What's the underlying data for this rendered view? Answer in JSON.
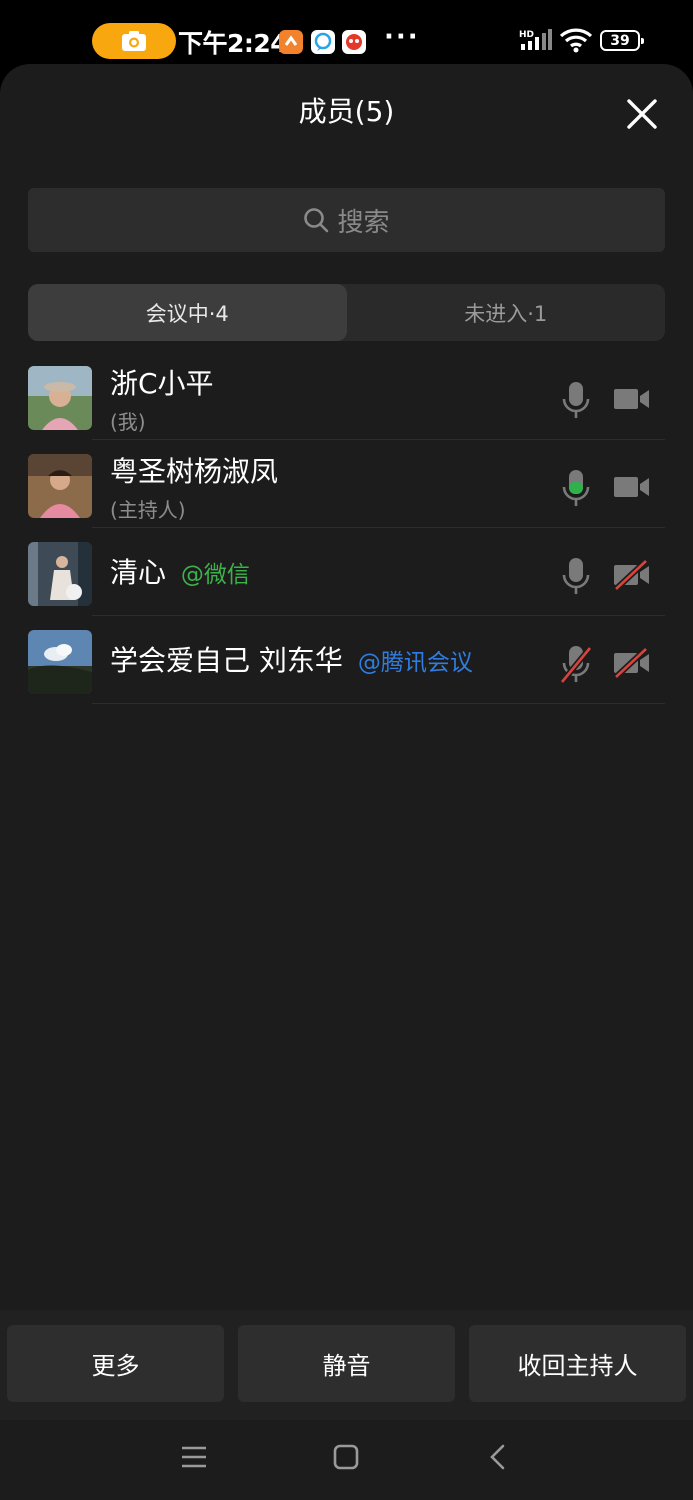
{
  "status_bar": {
    "time": "下午2:24",
    "more_dots": "···",
    "network": "HD",
    "battery": "39",
    "colors": {
      "recording_pill": "#f9a70e"
    }
  },
  "sheet": {
    "title": "成员(5)",
    "search_placeholder": "搜索",
    "tabs": [
      {
        "label": "会议中·4",
        "active": true
      },
      {
        "label": "未进入·1",
        "active": false
      }
    ]
  },
  "members": [
    {
      "name": "浙C小平",
      "tag": "",
      "sub": "(我)",
      "mic": "on",
      "camera": "off"
    },
    {
      "name": "粤圣树杨淑凤",
      "tag": "",
      "sub": "(主持人)",
      "mic": "speaking",
      "camera": "off"
    },
    {
      "name": "清心",
      "tag": "@微信",
      "tag_color": "#3cb34a",
      "sub": "",
      "mic": "on",
      "camera": "disabled"
    },
    {
      "name": "学会爱自己 刘东华",
      "tag": "@腾讯会议",
      "tag_color": "#2f7de1",
      "sub": "",
      "mic": "muted",
      "camera": "disabled"
    }
  ],
  "actions": {
    "more": "更多",
    "mute": "静音",
    "reclaim_host": "收回主持人"
  },
  "icons": [
    "camera-icon",
    "close-icon",
    "search-icon",
    "microphone-icon",
    "video-camera-icon",
    "menu-icon",
    "home-icon",
    "back-icon"
  ]
}
